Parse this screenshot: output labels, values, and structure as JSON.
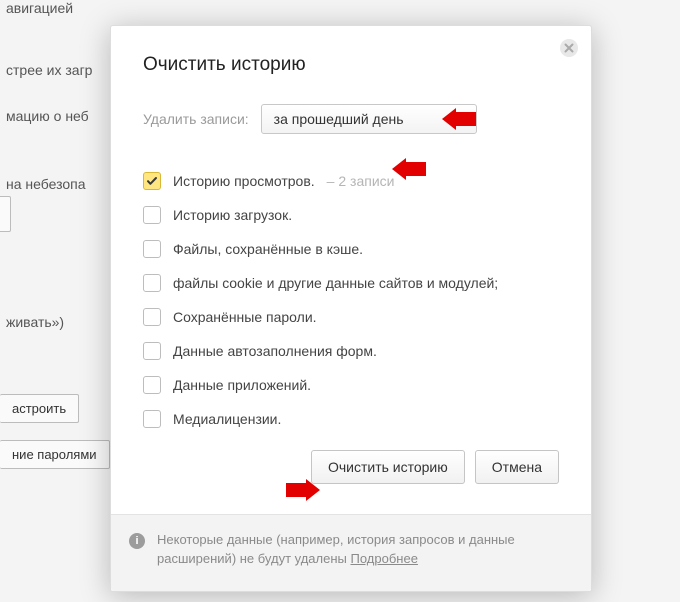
{
  "background": {
    "nav_fragment": "авигацией",
    "line1": "стрее их загр",
    "line2": "мацию о неб",
    "line3": "на небезопа",
    "line4": "живать»)",
    "btn_configure": "астроить",
    "btn_passwords": "ние паролями"
  },
  "dialog": {
    "title": "Очистить историю",
    "period_label": "Удалить записи:",
    "period_value": "за прошедший день",
    "options": [
      {
        "label": "Историю просмотров.",
        "checked": true,
        "count": "2 записи"
      },
      {
        "label": "Историю загрузок.",
        "checked": false
      },
      {
        "label": "Файлы, сохранённые в кэше.",
        "checked": false
      },
      {
        "label": "файлы cookie и другие данные сайтов и модулей;",
        "checked": false
      },
      {
        "label": "Сохранённые пароли.",
        "checked": false
      },
      {
        "label": "Данные автозаполнения форм.",
        "checked": false
      },
      {
        "label": "Данные приложений.",
        "checked": false
      },
      {
        "label": "Медиалицензии.",
        "checked": false
      }
    ],
    "clear_btn": "Очистить историю",
    "cancel_btn": "Отмена",
    "footer_text_1": "Некоторые данные (например, история запросов и данные расширений) не будут удалены ",
    "footer_more": "Подробнее"
  }
}
